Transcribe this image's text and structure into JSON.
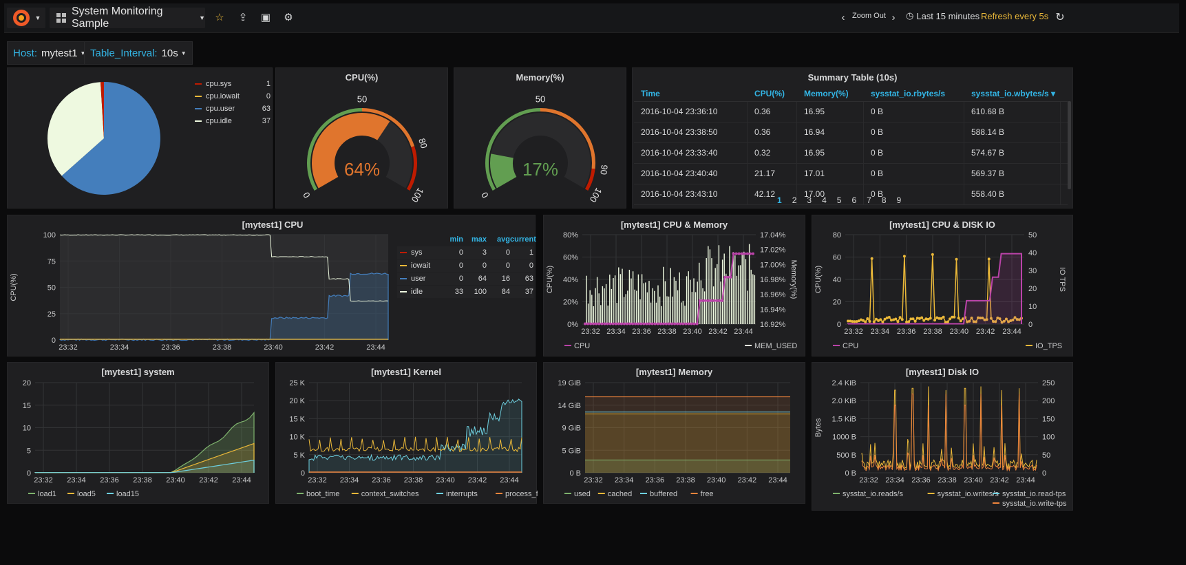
{
  "nav": {
    "title": "System Monitoring Sample",
    "zoom_out": "Zoom Out",
    "time_range": "Last 15 minutes",
    "refresh": "Refresh every 5s"
  },
  "vars": [
    {
      "key": "Host:",
      "value": "mytest1"
    },
    {
      "key": "Table_Interval:",
      "value": "10s"
    }
  ],
  "pie": {
    "legend": [
      {
        "name": "cpu.sys",
        "value": "1",
        "color": "#bf1b00"
      },
      {
        "name": "cpu.iowait",
        "value": "0",
        "color": "#eab839"
      },
      {
        "name": "cpu.user",
        "value": "63",
        "color": "#447ebc"
      },
      {
        "name": "cpu.idle",
        "value": "37",
        "color": "#eef9e0"
      }
    ]
  },
  "gauges": [
    {
      "title": "CPU(%)",
      "value_text": "64%",
      "value": 64,
      "color": "#e0752d",
      "ticks": [
        "0",
        "50",
        "80",
        "100"
      ],
      "thresholds": [
        50,
        80
      ]
    },
    {
      "title": "Memory(%)",
      "value_text": "17%",
      "value": 17,
      "color": "#629e51",
      "ticks": [
        "0",
        "50",
        "90",
        "100"
      ],
      "thresholds": [
        50,
        90
      ]
    }
  ],
  "summary": {
    "title": "Summary Table (10s)",
    "headers": [
      "Time",
      "CPU(%)",
      "Memory(%)",
      "sysstat_io.rbytes/s",
      "sysstat_io.wbytes/s"
    ],
    "rows": [
      [
        "2016-10-04 23:36:10",
        "0.36",
        "16.95",
        "0 B",
        "610.68 B"
      ],
      [
        "2016-10-04 23:38:50",
        "0.36",
        "16.94",
        "0 B",
        "588.14 B"
      ],
      [
        "2016-10-04 23:33:40",
        "0.32",
        "16.95",
        "0 B",
        "574.67 B"
      ],
      [
        "2016-10-04 23:40:40",
        "21.17",
        "17.01",
        "0 B",
        "569.37 B"
      ],
      [
        "2016-10-04 23:43:10",
        "42.12",
        "17.00",
        "0 B",
        "558.40 B"
      ]
    ],
    "pages": [
      "1",
      "2",
      "3",
      "4",
      "5",
      "6",
      "7",
      "8",
      "9"
    ]
  },
  "cpu_panel": {
    "title": "[mytest1] CPU",
    "ylabel": "CPU(%)",
    "yticks": [
      "0",
      "25",
      "50",
      "75",
      "100"
    ],
    "xticks": [
      "23:32",
      "23:34",
      "23:36",
      "23:38",
      "23:40",
      "23:42",
      "23:44"
    ],
    "legend_headers": [
      "min",
      "max",
      "avg",
      "current"
    ],
    "legend": [
      {
        "name": "sys",
        "color": "#bf1b00",
        "min": "0",
        "max": "3",
        "avg": "0",
        "current": "1"
      },
      {
        "name": "iowait",
        "color": "#eab839",
        "min": "0",
        "max": "0",
        "avg": "0",
        "current": "0"
      },
      {
        "name": "user",
        "color": "#447ebc",
        "min": "0",
        "max": "64",
        "avg": "16",
        "current": "63"
      },
      {
        "name": "idle",
        "color": "#eef9e0",
        "min": "33",
        "max": "100",
        "avg": "84",
        "current": "37"
      }
    ]
  },
  "cpu_mem": {
    "title": "[mytest1] CPU & Memory",
    "ylabel": "CPU(%)",
    "y2label": "Memory(%)",
    "yticks": [
      "0%",
      "20%",
      "40%",
      "60%",
      "80%"
    ],
    "y2ticks": [
      "16.92%",
      "16.94%",
      "16.96%",
      "16.98%",
      "17.00%",
      "17.02%",
      "17.04%"
    ],
    "xticks": [
      "23:32",
      "23:34",
      "23:36",
      "23:38",
      "23:40",
      "23:42",
      "23:44"
    ],
    "legend_left": "CPU",
    "legend_right": "MEM_USED"
  },
  "cpu_disk": {
    "title": "[mytest1] CPU & DISK IO",
    "ylabel": "CPU(%)",
    "y2label": "IO TPS",
    "yticks": [
      "0",
      "20",
      "40",
      "60",
      "80"
    ],
    "y2ticks": [
      "0",
      "10",
      "20",
      "30",
      "40",
      "50"
    ],
    "xticks": [
      "23:32",
      "23:34",
      "23:36",
      "23:38",
      "23:40",
      "23:42",
      "23:44"
    ],
    "legend_left": "CPU",
    "legend_right": "IO_TPS"
  },
  "system": {
    "title": "[mytest1] system",
    "yticks": [
      "0",
      "5",
      "10",
      "15",
      "20"
    ],
    "xticks": [
      "23:32",
      "23:34",
      "23:36",
      "23:38",
      "23:40",
      "23:42",
      "23:44"
    ],
    "legend": [
      "load1",
      "load5",
      "load15"
    ]
  },
  "kernel": {
    "title": "[mytest1] Kernel",
    "yticks": [
      "0",
      "5 K",
      "10 K",
      "15 K",
      "20 K",
      "25 K"
    ],
    "xticks": [
      "23:32",
      "23:34",
      "23:36",
      "23:38",
      "23:40",
      "23:42",
      "23:44"
    ],
    "legend": [
      "boot_time",
      "context_switches",
      "interrupts",
      "process_forked"
    ]
  },
  "memory": {
    "title": "[mytest1] Memory",
    "yticks": [
      "0 B",
      "5 GiB",
      "9 GiB",
      "14 GiB",
      "19 GiB"
    ],
    "xticks": [
      "23:32",
      "23:34",
      "23:36",
      "23:38",
      "23:40",
      "23:42",
      "23:44"
    ],
    "legend": [
      "used",
      "cached",
      "buffered",
      "free"
    ]
  },
  "diskio": {
    "title": "[mytest1] Disk IO",
    "ylabel": "Bytes",
    "y2label": "TPS",
    "yticks": [
      "0 B",
      "500 B",
      "1000 B",
      "1.5 KiB",
      "2.0 KiB",
      "2.4 KiB"
    ],
    "y2ticks": [
      "0",
      "50",
      "100",
      "150",
      "200",
      "250"
    ],
    "xticks": [
      "23:32",
      "23:34",
      "23:36",
      "23:38",
      "23:40",
      "23:42",
      "23:44"
    ],
    "legend": [
      "sysstat_io.reads/s",
      "sysstat_io.writes/s",
      "sysstat_io.read-tps",
      "sysstat_io.write-tps"
    ]
  }
}
